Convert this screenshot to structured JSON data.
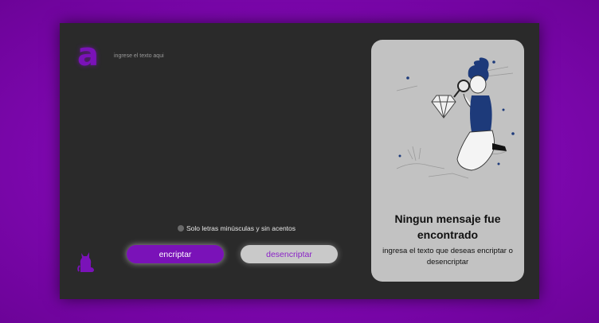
{
  "app": {
    "logo_letter": "a",
    "textarea": {
      "placeholder": "ingrese el texto aqui",
      "value": ""
    },
    "hint": {
      "icon": "info-circle-icon",
      "text": "Solo letras minúsculas y sin acentos"
    },
    "buttons": {
      "encrypt_label": "encriptar",
      "decrypt_label": "desencriptar"
    },
    "mascot_icon": "cat-icon"
  },
  "panel": {
    "illustration": "person-with-magnifier-and-diamond",
    "title": "Ningun mensaje fue encontrado",
    "description": "ingresa el texto que deseas encriptar o desencriptar"
  },
  "colors": {
    "page_background": "#7c07ad",
    "card_background": "#2a2a2a",
    "accent": "#7a12b8",
    "panel_background": "#c2c2c2",
    "decrypt_button": "#c9c9c9"
  }
}
